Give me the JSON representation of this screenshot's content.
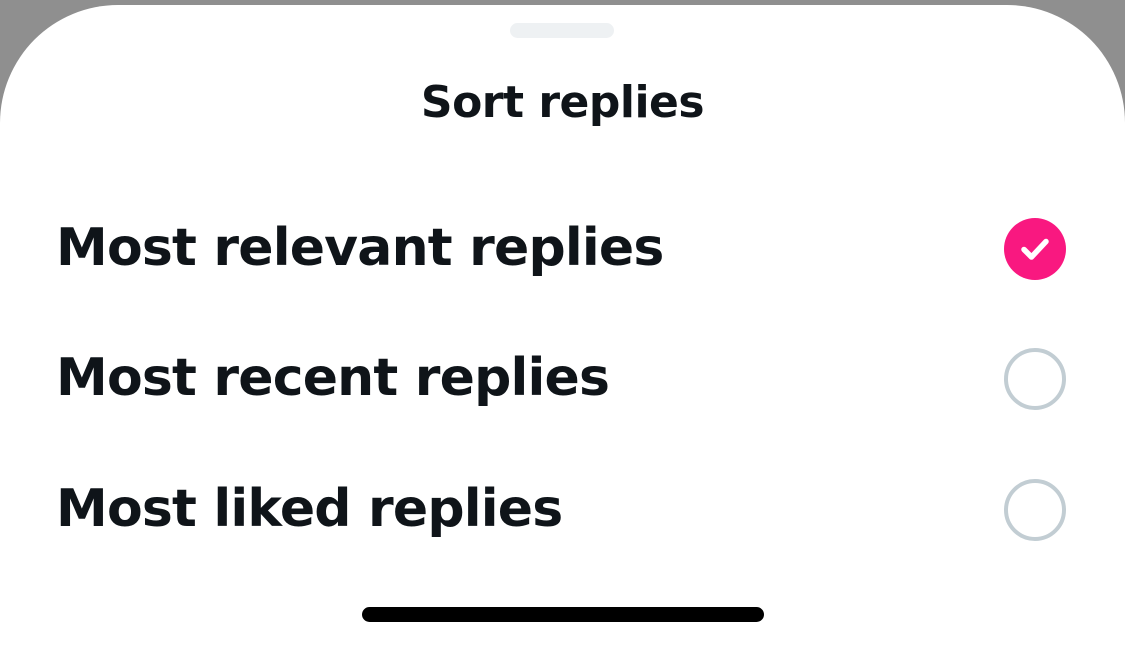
{
  "sheet": {
    "title": "Sort replies"
  },
  "options": [
    {
      "label": "Most relevant replies",
      "selected": true
    },
    {
      "label": "Most recent replies",
      "selected": false
    },
    {
      "label": "Most liked replies",
      "selected": false
    }
  ],
  "colors": {
    "accent": "#f91880",
    "text": "#0f1419",
    "radio_border": "#c2cdd3",
    "grabber": "#eef1f3",
    "home_indicator": "#000000"
  },
  "icons": {
    "selected": "checkmark-icon"
  }
}
